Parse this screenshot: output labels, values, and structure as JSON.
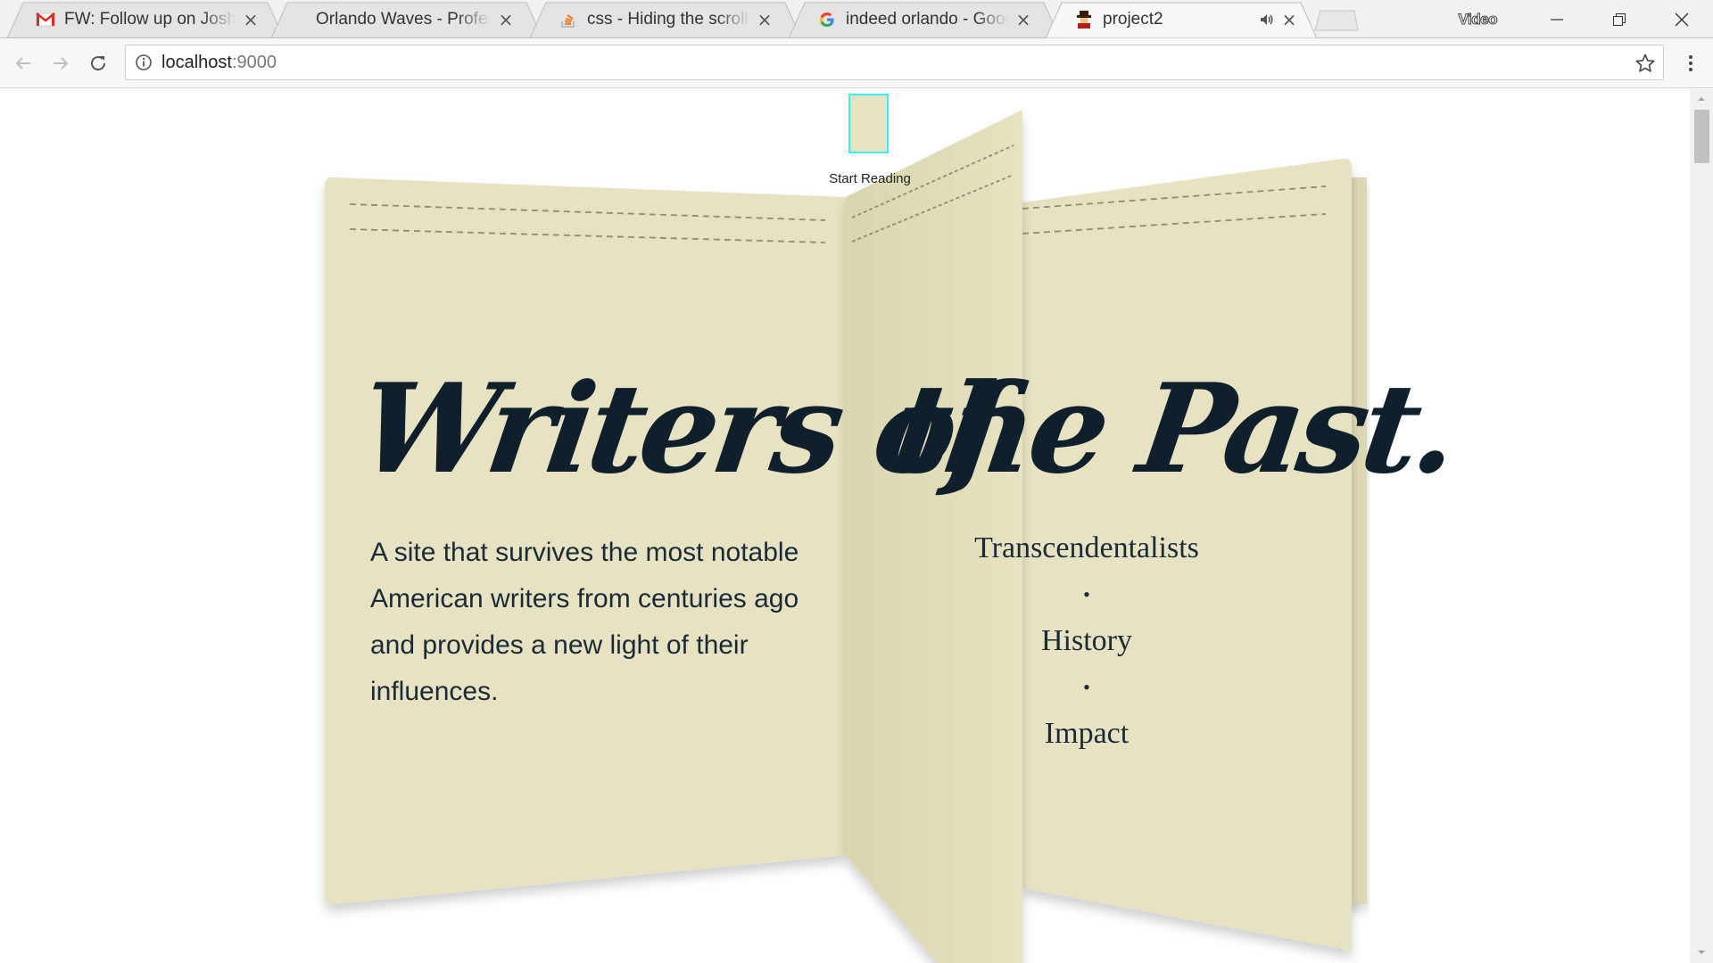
{
  "browser": {
    "tabs": [
      {
        "title": "FW: Follow up on Joshua",
        "favicon": "gmail-icon",
        "active": false
      },
      {
        "title": "Orlando Waves - Professi",
        "favicon": "none",
        "active": false
      },
      {
        "title": "css - Hiding the scrollbar",
        "favicon": "stackoverflow-icon",
        "active": false
      },
      {
        "title": "indeed orlando - Google",
        "favicon": "google-icon",
        "active": false
      },
      {
        "title": "project2",
        "favicon": "project-avatar-icon",
        "active": true,
        "audio": true
      }
    ],
    "window_label": "Video",
    "url_host": "localhost",
    "url_port": ":9000"
  },
  "page": {
    "start_reading": "Start Reading",
    "title_left": "Writers of",
    "title_right": "the Past.",
    "description": "A site that survives the most notable American writers from centuries ago and provides a new light of their influences.",
    "topics": [
      "Transcendentalists",
      "History",
      "Impact"
    ],
    "topic_separator": "•"
  },
  "colors": {
    "page_paper": "#e6e3c2",
    "ink": "#0f1f2c",
    "start_border": "#38f0ee"
  }
}
